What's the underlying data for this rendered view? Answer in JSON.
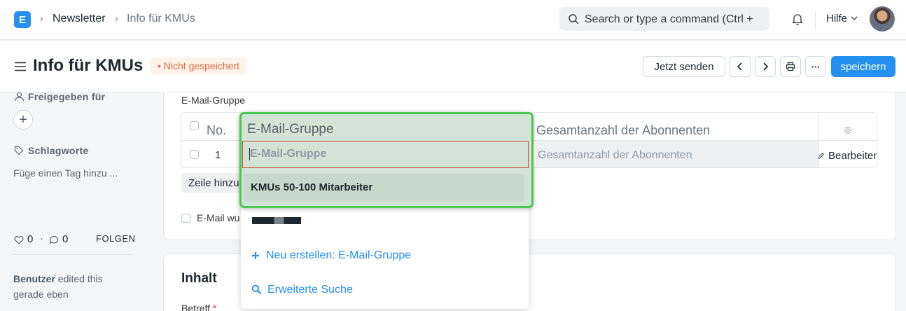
{
  "navbar": {
    "logo_letter": "E",
    "breadcrumbs": [
      "Newsletter",
      "Info für KMUs"
    ],
    "search_placeholder": "Search or type a command (Ctrl +",
    "help_label": "Hilfe"
  },
  "page": {
    "title": "Info für KMUs",
    "status_badge": "Nicht gespeichert",
    "send_now_label": "Jetzt senden",
    "save_label": "speichern",
    "more_label": "···"
  },
  "sidebar": {
    "shared_with_label": "Freigegeben für",
    "tags_label": "Schlagworte",
    "add_tag_label": "Füge einen Tag hinzu ...",
    "likes_count": "0",
    "comments_count": "0",
    "follow_label": "FOLGEN",
    "activity_user": "Benutzer",
    "activity_text": " edited this",
    "activity_time": "gerade eben"
  },
  "form": {
    "email_group_section_label": "E-Mail-Gruppe",
    "table": {
      "columns": [
        "No.",
        "E-Mail-Gruppe",
        "Gesamtanzahl der Abonnenten"
      ],
      "rows": [
        {
          "no": "1",
          "email_group_placeholder": "E-Mail-Gruppe",
          "subscribers_placeholder": "Gesamtanzahl der Abonnenten",
          "edit_label": "Bearbeiten"
        }
      ],
      "add_row_label": "Zeile hinzufügen"
    },
    "email_checkbox_label": "E-Mail wurde gesendet",
    "content_section_title": "Inhalt",
    "subject_label": "Betreff",
    "required_mark": "*"
  },
  "dropdown": {
    "options": [
      "KMUs 50-100 Mitarbeiter"
    ],
    "create_new_label": "Neu erstellen: E-Mail-Gruppe",
    "advanced_search_label": "Erweiterte Suche"
  },
  "colors": {
    "primary": "#2490ef",
    "warning": "#e5693c",
    "highlight_green": "#49c94f"
  }
}
